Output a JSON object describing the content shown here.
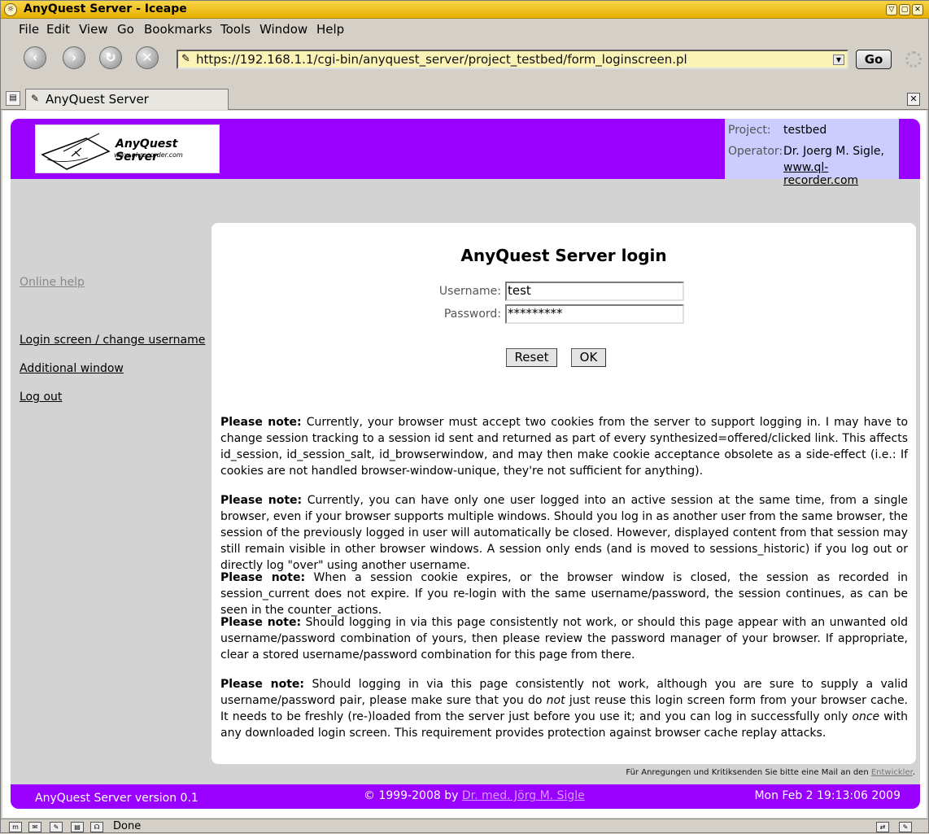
{
  "window": {
    "title": "AnyQuest Server - Iceape"
  },
  "menu": [
    "File",
    "Edit",
    "View",
    "Go",
    "Bookmarks",
    "Tools",
    "Window",
    "Help"
  ],
  "nav": {
    "url": "https://192.168.1.1/cgi-bin/anyquest_server/project_testbed/form_loginscreen.pl",
    "go_label": "Go"
  },
  "tab": {
    "label": "AnyQuest Server"
  },
  "header": {
    "logo_title": "AnyQuest Server",
    "logo_subtitle": "www.ql-recorder.com",
    "project_key": "Project:",
    "project_value": "testbed",
    "operator_key": "Operator:",
    "operator_value": "Dr. Joerg M. Sigle,",
    "operator_link": "www.ql-recorder.com"
  },
  "sidebar": {
    "online_help": "Online help",
    "login_screen": "Login screen / change username",
    "additional_window": "Additional window",
    "log_out": "Log out"
  },
  "login": {
    "heading": "AnyQuest Server login",
    "username_label": "Username:",
    "username_value": "test",
    "password_label": "Password:",
    "password_value": "*********",
    "reset_label": "Reset",
    "ok_label": "OK"
  },
  "notes": {
    "lead": "Please note:",
    "n1": "Currently, your browser must accept two cookies from the server to support logging in. I may have to change session tracking to a session id sent and returned as part of every synthesized=offered/clicked link. This affects id_session, id_session_salt, id_browserwindow, and may then make cookie acceptance obsolete as a side-effect (i.e.: If cookies are not handled browser-window-unique, they're not sufficient for anything).",
    "n2": "Currently, you can have only one user logged into an active session at the same time, from a single browser, even if your browser supports multiple windows. Should you log in as another user from the same browser, the session of the previously logged in user will automatically be closed. However, displayed content from that session may still remain visible in other browser windows. A session only ends (and is moved to sessions_historic) if you log out or directly log \"over\" using another username.",
    "n3": "When a session cookie expires, or the browser window is closed, the session as recorded in session_current does not expire. If you re-login with the same username/password, the session continues, as can be seen in the counter_actions.",
    "n4": "Should logging in via this page consistently not work, or should this page appear with an unwanted old username/password combination of yours, then please review the password manager of your browser. If appropriate, clear a stored username/password combination for this page from there.",
    "n5a": "Should logging in via this page consistently not work, although you are sure to supply a valid username/password pair, please make sure that you do",
    "n5_em1": "not",
    "n5b": "just reuse this login screen form from your browser cache. It needs to be freshly (re-)loaded from the server just before you use it; and you can log in successfully only",
    "n5_em2": "once",
    "n5c": "with any downloaded login screen. This requirement provides protection against browser cache replay attacks."
  },
  "footnote": {
    "text": "Für Anregungen und Kritiksenden Sie bitte eine Mail an den",
    "link": "Entwickler",
    "tail": "."
  },
  "footer": {
    "version": "AnyQuest Server version 0.1",
    "copyright": "© 1999-2008 by",
    "author_link": "Dr. med. Jörg M. Sigle",
    "datetime": "Mon Feb 2 19:13:06 2009"
  },
  "status": {
    "text": "Done"
  }
}
